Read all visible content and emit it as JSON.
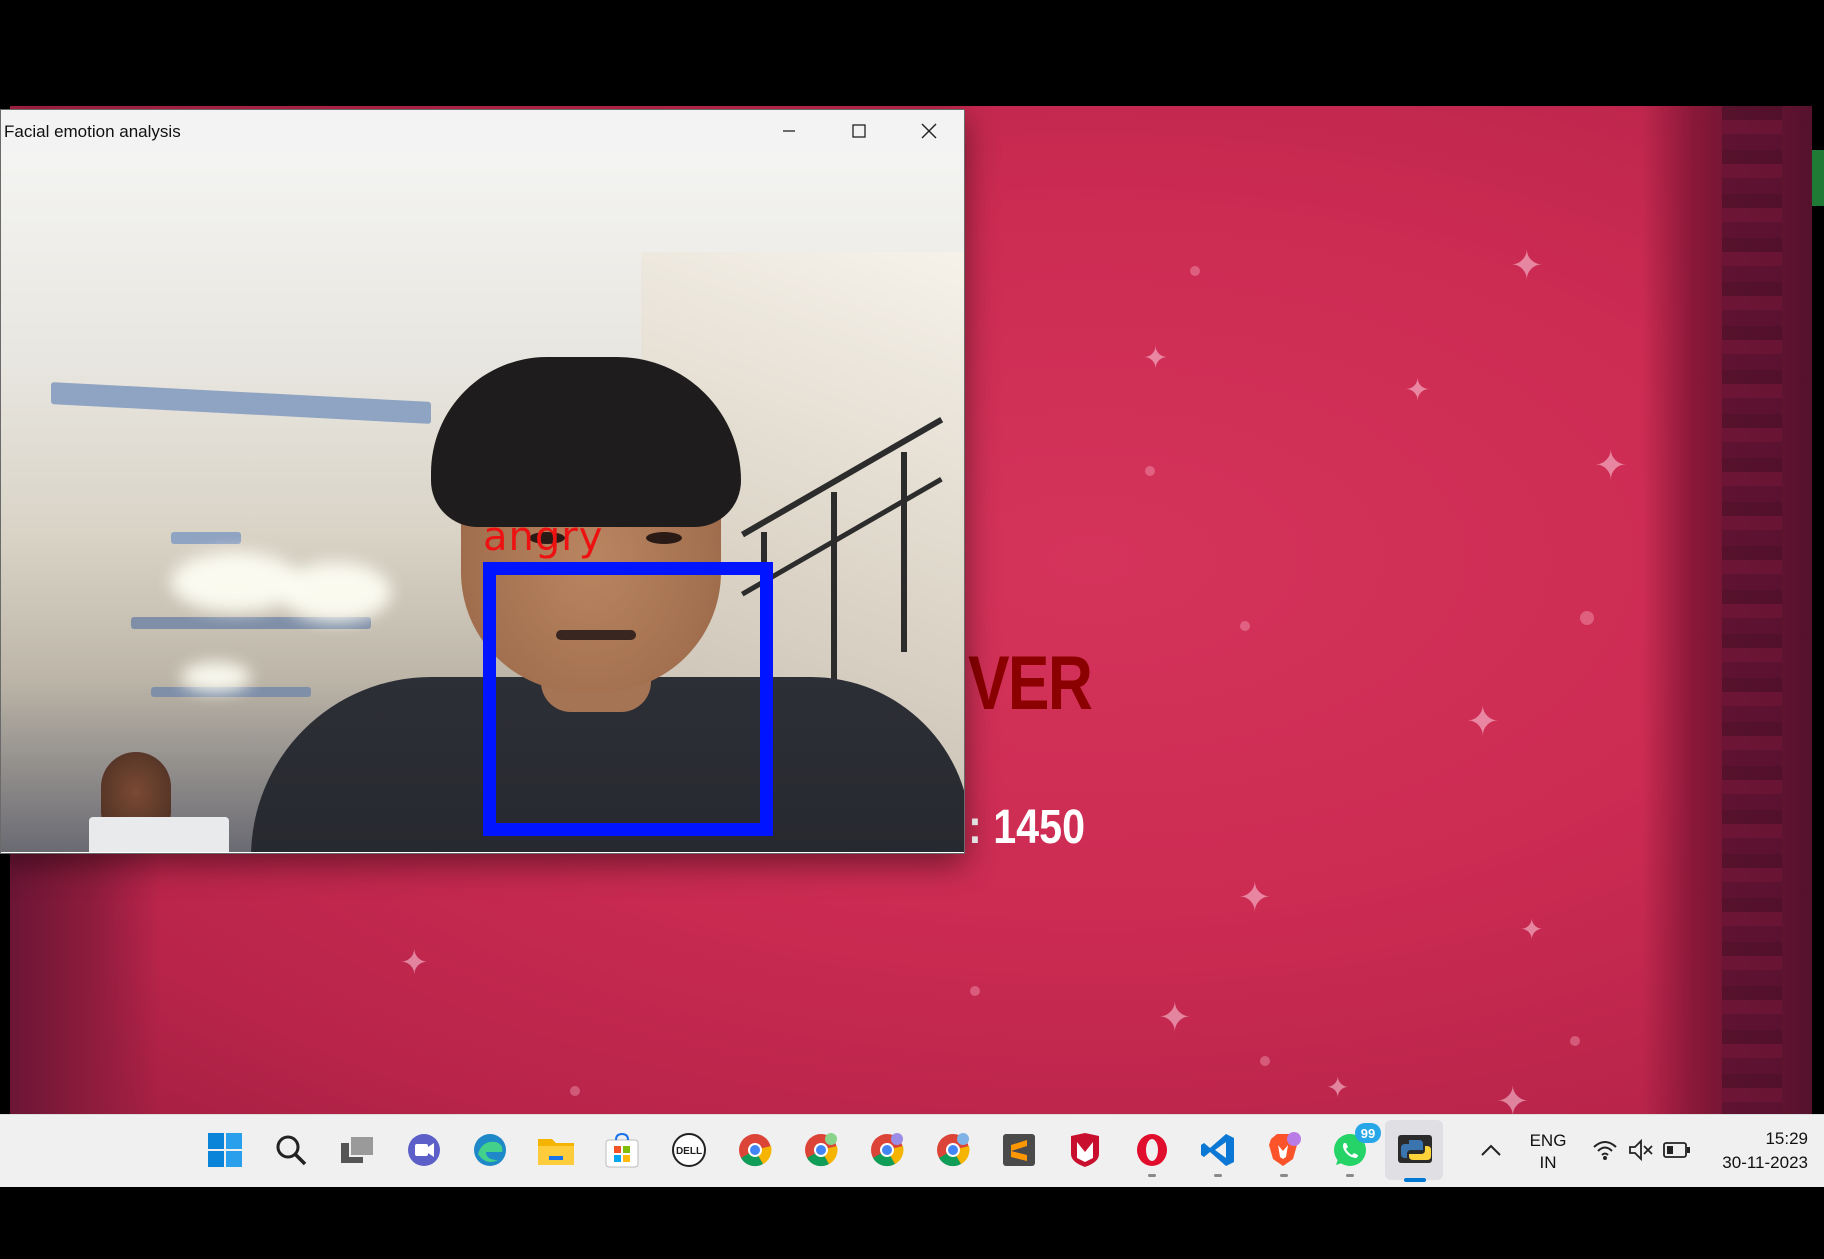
{
  "game": {
    "title_partial": "VER",
    "score_partial": ": 1450"
  },
  "emotion_window": {
    "title": "Facial emotion analysis",
    "detected_emotion": "angry",
    "box_color": "#0014ff",
    "label_color": "#ee1111",
    "controls": [
      "minimize-icon",
      "maximize-icon",
      "close-icon"
    ]
  },
  "taskbar": {
    "icons": [
      "windows-start-icon",
      "search-icon",
      "task-view-icon",
      "teams-chat-icon",
      "edge-icon",
      "file-explorer-icon",
      "microsoft-store-icon",
      "dell-icon",
      "chrome-icon",
      "chrome-profile-icon",
      "chrome-profile-icon",
      "chrome-profile-icon",
      "sublime-text-icon",
      "mcafee-icon",
      "opera-icon",
      "vscode-icon",
      "brave-icon",
      "whatsapp-icon",
      "python-icon"
    ],
    "whatsapp_badge": "99"
  },
  "tray": {
    "language_line1": "ENG",
    "language_line2": "IN",
    "time": "15:29",
    "date": "30-11-2023",
    "icons": [
      "chevron-up-icon",
      "wifi-icon",
      "speaker-muted-icon",
      "battery-icon"
    ]
  }
}
